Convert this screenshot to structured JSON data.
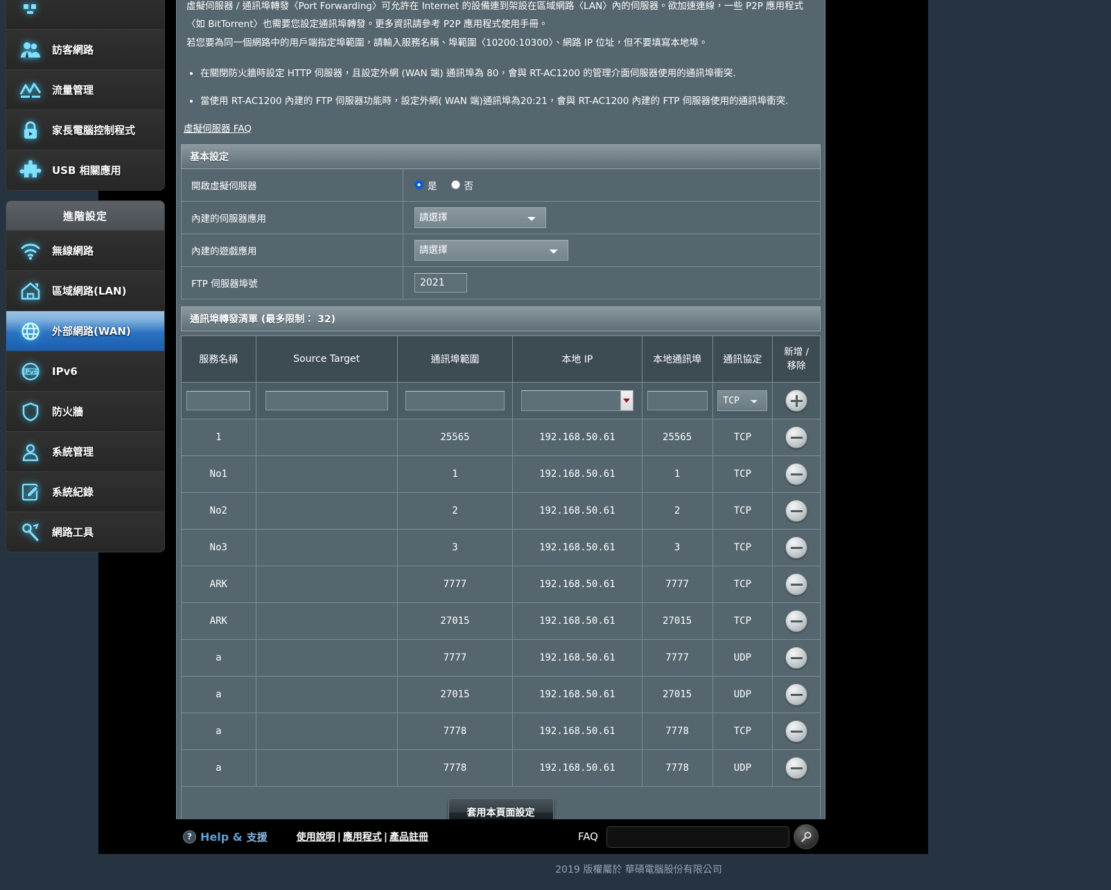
{
  "sidebar": {
    "general_items": [
      {
        "label": "訪客網路",
        "icon": "guests-icon"
      },
      {
        "label": "流量管理",
        "icon": "traffic-chart-icon"
      },
      {
        "label": "家長電腦控制程式",
        "icon": "lock-icon"
      },
      {
        "label": "USB 相關應用",
        "icon": "puzzle-icon"
      }
    ],
    "advanced_title": "進階設定",
    "advanced_items": [
      {
        "label": "無線網路",
        "icon": "wifi-icon",
        "active": false
      },
      {
        "label": "區域網路(LAN)",
        "icon": "home-icon",
        "active": false
      },
      {
        "label": "外部網路(WAN)",
        "icon": "globe-icon",
        "active": true
      },
      {
        "label": "IPv6",
        "icon": "ipv6-globe-icon",
        "active": false
      },
      {
        "label": "防火牆",
        "icon": "shield-icon",
        "active": false
      },
      {
        "label": "系統管理",
        "icon": "user-icon",
        "active": false
      },
      {
        "label": "系統紀錄",
        "icon": "notepad-pencil-icon",
        "active": false
      },
      {
        "label": "網路工具",
        "icon": "wrench-icon",
        "active": false
      }
    ]
  },
  "description": {
    "para1": "虛擬伺服器 / 通訊埠轉發〈Port Forwarding〉可允許在 Internet 的設備連到架設在區域網路〈LAN〉內的伺服器。欲加速連線，一些 P2P 應用程式〈如 BitTorrent〉也需要您設定通訊埠轉發。更多資訊請參考 P2P 應用程式使用手冊。",
    "para2": "若您要為同一個網路中的用戶端指定埠範圍，請輸入服務名稱、埠範圍〈10200:10300〉、網路 IP 位址，但不要填寫本地埠。",
    "bullet1": "在關閉防火牆時設定 HTTP 伺服器，且設定外網 (WAN 端) 通訊埠為 80，會與 RT-AC1200 的管理介面伺服器使用的通訊埠衝突.",
    "bullet2": "當使用 RT-AC1200 內建的 FTP 伺服器功能時，設定外網( WAN 端)通訊埠為20:21，會與 RT-AC1200 內建的 FTP 伺服器使用的通訊埠衝突.",
    "faq_link": "虛擬伺服器 FAQ"
  },
  "basic": {
    "section_title": "基本設定",
    "enable_label": "開啟虛擬伺服器",
    "enable_yes": "是",
    "enable_no": "否",
    "enable_value": "yes",
    "famous_server_label": "內建的伺服器應用",
    "famous_server_value": "請選擇",
    "famous_game_label": "內建的遊戲應用",
    "famous_game_value": "請選擇",
    "ftp_port_label": "FTP 伺服器埠號",
    "ftp_port_value": "2021"
  },
  "forwarding": {
    "section_title": "通訊埠轉發清單 (最多限制： 32)",
    "columns": {
      "service": "服務名稱",
      "source": "Source Target",
      "port_range": "通訊埠範圍",
      "local_ip": "本地 IP",
      "local_port": "本地通訊埠",
      "protocol": "通訊協定",
      "action_add": "新增 /",
      "action_del": "移除"
    },
    "entry_row": {
      "service": "",
      "source": "",
      "port_range": "",
      "local_ip": "",
      "local_port": "",
      "protocol": "TCP"
    },
    "rows": [
      {
        "service": "1",
        "source": "",
        "port_range": "25565",
        "local_ip": "192.168.50.61",
        "local_port": "25565",
        "protocol": "TCP"
      },
      {
        "service": "No1",
        "source": "",
        "port_range": "1",
        "local_ip": "192.168.50.61",
        "local_port": "1",
        "protocol": "TCP"
      },
      {
        "service": "No2",
        "source": "",
        "port_range": "2",
        "local_ip": "192.168.50.61",
        "local_port": "2",
        "protocol": "TCP"
      },
      {
        "service": "No3",
        "source": "",
        "port_range": "3",
        "local_ip": "192.168.50.61",
        "local_port": "3",
        "protocol": "TCP"
      },
      {
        "service": "ARK",
        "source": "",
        "port_range": "7777",
        "local_ip": "192.168.50.61",
        "local_port": "7777",
        "protocol": "TCP"
      },
      {
        "service": "ARK",
        "source": "",
        "port_range": "27015",
        "local_ip": "192.168.50.61",
        "local_port": "27015",
        "protocol": "TCP"
      },
      {
        "service": "a",
        "source": "",
        "port_range": "7777",
        "local_ip": "192.168.50.61",
        "local_port": "7777",
        "protocol": "UDP"
      },
      {
        "service": "a",
        "source": "",
        "port_range": "27015",
        "local_ip": "192.168.50.61",
        "local_port": "27015",
        "protocol": "UDP"
      },
      {
        "service": "a",
        "source": "",
        "port_range": "7778",
        "local_ip": "192.168.50.61",
        "local_port": "7778",
        "protocol": "TCP"
      },
      {
        "service": "a",
        "source": "",
        "port_range": "7778",
        "local_ip": "192.168.50.61",
        "local_port": "7778",
        "protocol": "UDP"
      }
    ],
    "apply_label": "套用本頁面設定"
  },
  "footer": {
    "help_text": "Help &",
    "help_text2": "支援",
    "link_manual": "使用說明",
    "link_apps": "應用程式",
    "link_register": "產品註冊",
    "faq_label": "FAQ",
    "search_value": "",
    "copyright": "2019 版權屬於 華碩電腦股份有限公司"
  },
  "colors": {
    "background": "#263340",
    "panel": "#55666e",
    "header_row": "#3d4b53",
    "active_menu": "#1b5fae",
    "icon_glow": "#39c8f5"
  }
}
